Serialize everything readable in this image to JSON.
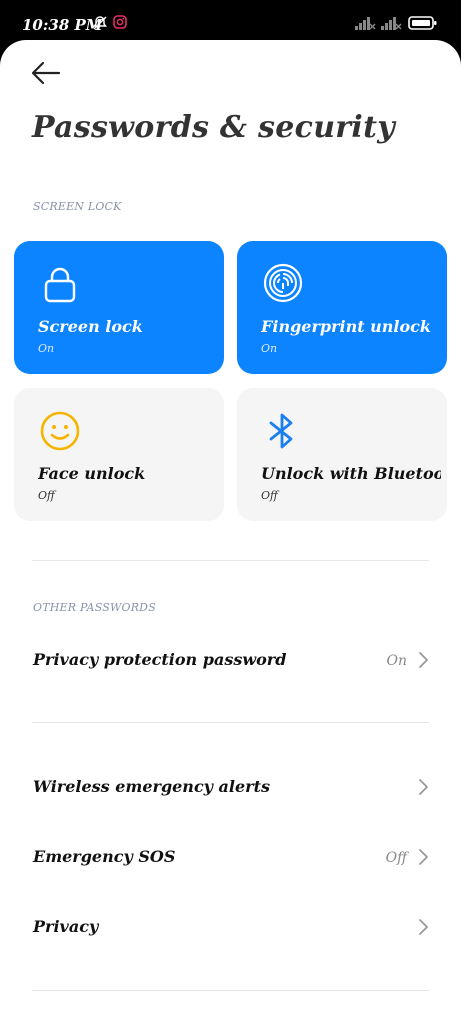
{
  "status_bar": {
    "time": "10:38 PM",
    "icons": [
      "notifications-muted-icon",
      "instagram-icon",
      "signal-icon",
      "signal-icon",
      "battery-icon"
    ]
  },
  "header": {
    "back_icon": "arrow-left-icon",
    "title": "Passwords & security"
  },
  "screen_lock_section": {
    "label": "SCREEN LOCK",
    "tiles": [
      {
        "title": "Screen lock",
        "status": "On",
        "icon": "lock-icon",
        "active": true
      },
      {
        "title": "Fingerprint unlock",
        "status": "On",
        "icon": "fingerprint-icon",
        "active": true
      },
      {
        "title": "Face unlock",
        "status": "Off",
        "icon": "smiley-face-icon",
        "active": false
      },
      {
        "title": "Unlock with Bluetooth",
        "status": "Off",
        "icon": "bluetooth-icon",
        "active": false
      }
    ]
  },
  "other_passwords_section": {
    "label": "OTHER PASSWORDS",
    "rows": [
      {
        "label": "Privacy protection password",
        "value": "On"
      }
    ]
  },
  "misc_section": {
    "rows": [
      {
        "label": "Wireless emergency alerts",
        "value": ""
      },
      {
        "label": "Emergency SOS",
        "value": "Off"
      },
      {
        "label": "Privacy",
        "value": ""
      }
    ]
  },
  "colors": {
    "accent": "#0d84ff",
    "tile_off_bg": "#f5f5f5",
    "face_icon": "#f5b400",
    "bluetooth_icon": "#1a7ff0"
  }
}
